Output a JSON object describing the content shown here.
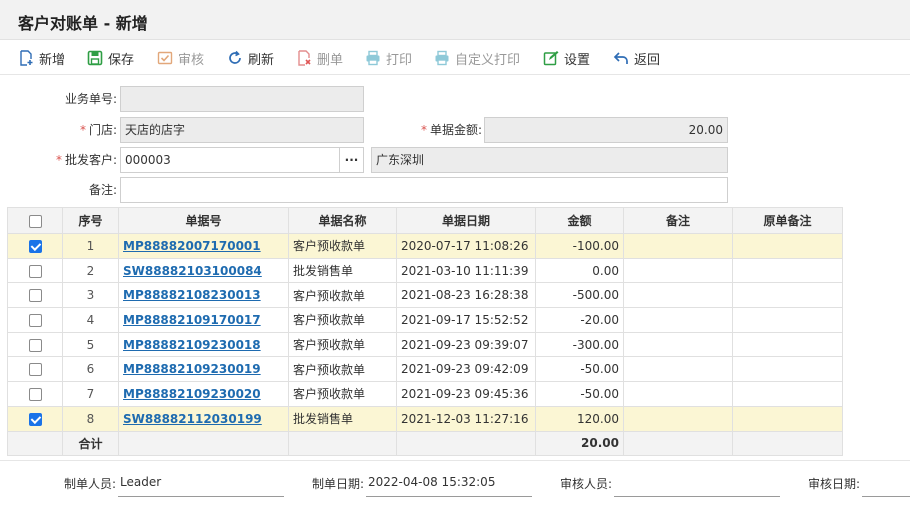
{
  "title": "客户对账单 - 新增",
  "toolbar": {
    "new": "新增",
    "save": "保存",
    "audit": "审核",
    "refresh": "刷新",
    "delete": "删单",
    "print": "打印",
    "custom_print": "自定义打印",
    "settings": "设置",
    "back": "返回"
  },
  "form": {
    "biz_no_label": "业务单号:",
    "biz_no_value": "",
    "store_label": "门店:",
    "store_value": "天店的店字",
    "amount_label": "单据金额:",
    "amount_value": "20.00",
    "customer_label": "批发客户:",
    "customer_value": "000003",
    "customer_lookup": "···",
    "customer_name": "广东深圳",
    "remark_label": "备注:",
    "remark_value": ""
  },
  "grid": {
    "headers": [
      "序号",
      "单据号",
      "单据名称",
      "单据日期",
      "金额",
      "备注",
      "原单备注"
    ],
    "rows": [
      {
        "checked": true,
        "no": "1",
        "doc": "MP88882007170001",
        "name": "客户预收款单",
        "date": "2020-07-17 11:08:26",
        "amount": "-100.00",
        "remark": "",
        "orig_remark": ""
      },
      {
        "checked": false,
        "no": "2",
        "doc": "SW88882103100084",
        "name": "批发销售单",
        "date": "2021-03-10 11:11:39",
        "amount": "0.00",
        "remark": "",
        "orig_remark": ""
      },
      {
        "checked": false,
        "no": "3",
        "doc": "MP88882108230013",
        "name": "客户预收款单",
        "date": "2021-08-23 16:28:38",
        "amount": "-500.00",
        "remark": "",
        "orig_remark": ""
      },
      {
        "checked": false,
        "no": "4",
        "doc": "MP88882109170017",
        "name": "客户预收款单",
        "date": "2021-09-17 15:52:52",
        "amount": "-20.00",
        "remark": "",
        "orig_remark": ""
      },
      {
        "checked": false,
        "no": "5",
        "doc": "MP88882109230018",
        "name": "客户预收款单",
        "date": "2021-09-23 09:39:07",
        "amount": "-300.00",
        "remark": "",
        "orig_remark": ""
      },
      {
        "checked": false,
        "no": "6",
        "doc": "MP88882109230019",
        "name": "客户预收款单",
        "date": "2021-09-23 09:42:09",
        "amount": "-50.00",
        "remark": "",
        "orig_remark": ""
      },
      {
        "checked": false,
        "no": "7",
        "doc": "MP88882109230020",
        "name": "客户预收款单",
        "date": "2021-09-23 09:45:36",
        "amount": "-50.00",
        "remark": "",
        "orig_remark": ""
      },
      {
        "checked": true,
        "no": "8",
        "doc": "SW88882112030199",
        "name": "批发销售单",
        "date": "2021-12-03 11:27:16",
        "amount": "120.00",
        "remark": "",
        "orig_remark": ""
      }
    ],
    "total_label": "合计",
    "total_amount": "20.00"
  },
  "footer": {
    "maker_label": "制单人员:",
    "maker_value": "Leader",
    "make_date_label": "制单日期:",
    "make_date_value": "2022-04-08 15:32:05",
    "auditor_label": "审核人员:",
    "auditor_value": "",
    "audit_date_label": "审核日期:",
    "audit_date_value": ""
  },
  "colors": {
    "link": "#1e6bb0",
    "selected_row": "#fbf6d4",
    "checkbox_on": "#1a73e8",
    "required": "#d9534f"
  }
}
